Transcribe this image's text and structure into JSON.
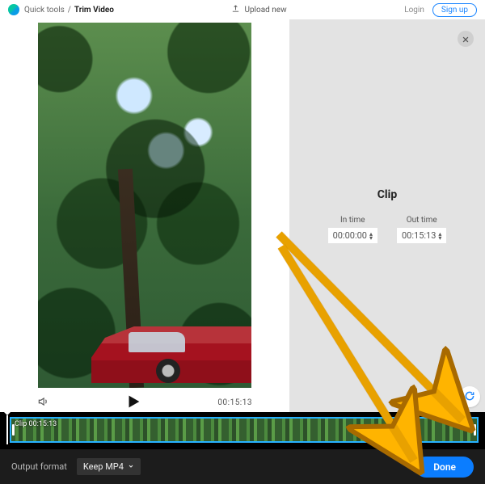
{
  "header": {
    "breadcrumb_root": "Quick tools",
    "breadcrumb_sep": "/",
    "breadcrumb_current": "Trim Video",
    "upload_label": "Upload new",
    "login_label": "Login",
    "signup_label": "Sign up"
  },
  "player": {
    "duration_display": "00:15:13"
  },
  "sidepanel": {
    "title": "Clip",
    "in_label": "In time",
    "out_label": "Out time",
    "in_value": "00:00:00",
    "out_value": "00:15:13"
  },
  "timeline": {
    "clip_label": "Clip 00:15:13"
  },
  "footer": {
    "output_format_label": "Output format",
    "format_selected": "Keep MP4",
    "done_label": "Done"
  },
  "colors": {
    "accent_blue": "#1c86ff",
    "timeline_select": "#27b2ff",
    "done_button": "#0b7dff",
    "arrow": "#ffb400"
  }
}
